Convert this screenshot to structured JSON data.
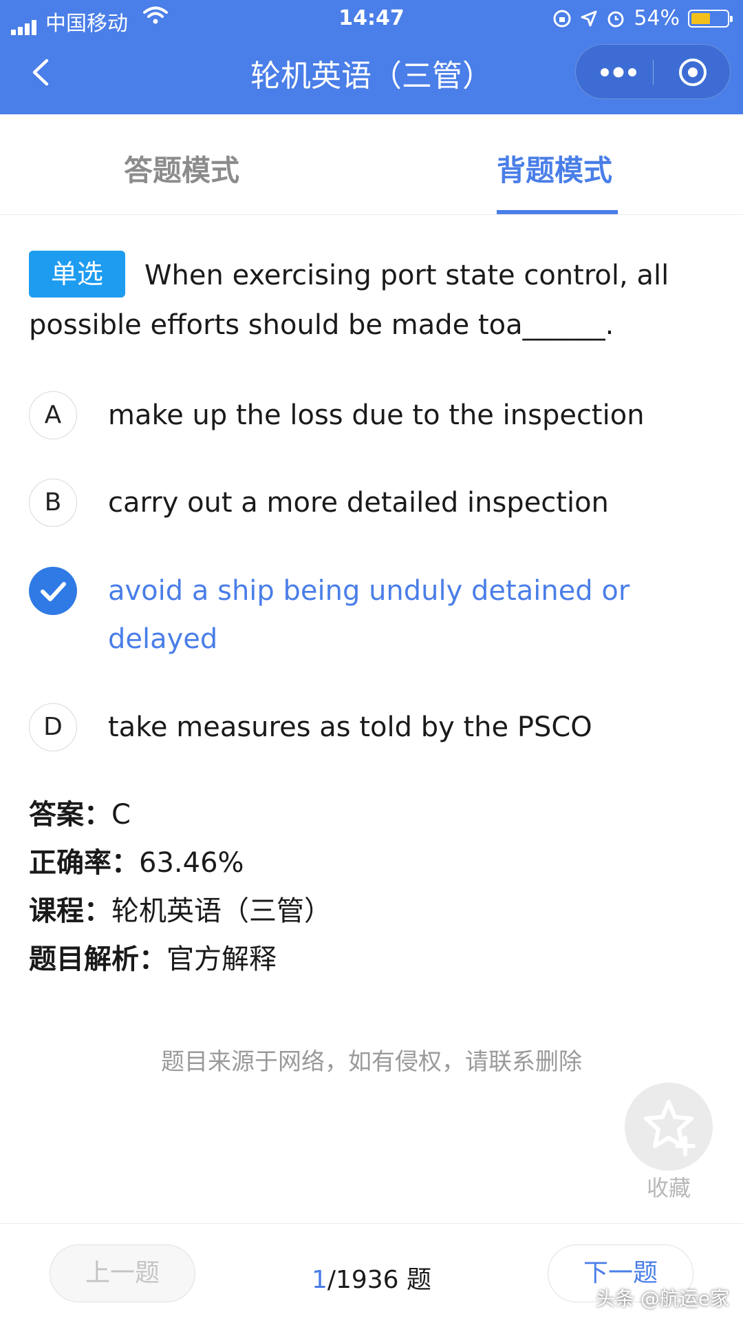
{
  "status_bar": {
    "carrier": "中国移动",
    "time": "14:47",
    "battery": "54%",
    "battery_level": 0.54
  },
  "nav": {
    "title": "轮机英语（三管）"
  },
  "tabs": [
    {
      "label": "答题模式"
    },
    {
      "label": "背题模式"
    }
  ],
  "question": {
    "type_badge": "单选",
    "text": "When exercising port state control, all possible efforts should be made toa______."
  },
  "options": [
    {
      "letter": "A",
      "text": "make up the loss due to the inspection"
    },
    {
      "letter": "B",
      "text": "carry out a more detailed inspection"
    },
    {
      "letter": "C",
      "text": "avoid a ship being unduly detained or delayed",
      "selected": true
    },
    {
      "letter": "D",
      "text": "take measures as told by the PSCO"
    }
  ],
  "info": {
    "answer_label": "答案：",
    "answer_value": "C",
    "accuracy_label": "正确率：",
    "accuracy_value": "63.46%",
    "course_label": "课程：",
    "course_value": "轮机英语（三管）",
    "analysis_label": "题目解析：",
    "analysis_value": "官方解释"
  },
  "disclaimer": "题目来源于网络，如有侵权，请联系删除",
  "favorite": {
    "label": "收藏"
  },
  "footer": {
    "prev_label": "上一题",
    "next_label": "下一题",
    "current": "1",
    "total": "/1936",
    "unit": " 题"
  },
  "watermark": "头条 @航运e家",
  "colors": {
    "primary": "#4a7ee8",
    "badge": "#1e9cf0"
  }
}
